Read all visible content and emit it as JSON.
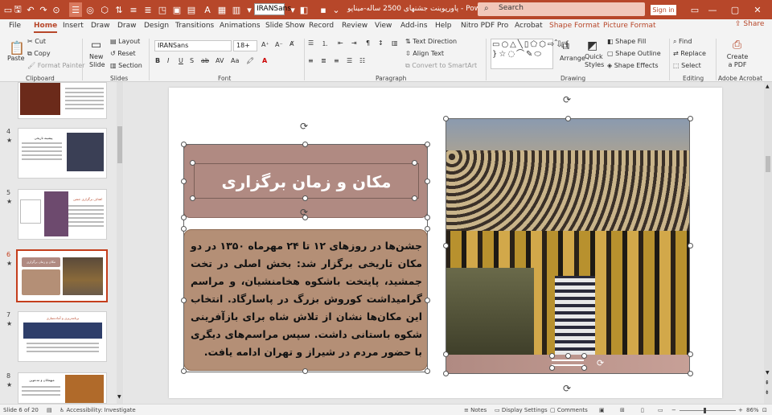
{
  "title_bar": {
    "font_name": "IRANSans",
    "document_title": "پاورپوینت جشنهای 2500 ساله-میناپو - PowerPoint",
    "search_placeholder": "Search",
    "sign_in": "Sign in"
  },
  "tabs": [
    "File",
    "Home",
    "Insert",
    "Draw",
    "Draw",
    "Design",
    "Transitions",
    "Animations",
    "Slide Show",
    "Record",
    "Review",
    "View",
    "Add-ins",
    "Help",
    "Nitro PDF Pro",
    "Acrobat",
    "Shape Format",
    "Picture Format"
  ],
  "active_tab": "Home",
  "share_label": "Share",
  "ribbon": {
    "clipboard": {
      "paste": "Paste",
      "cut": "Cut",
      "copy": "Copy",
      "format_painter": "Format Painter",
      "group": "Clipboard"
    },
    "slides": {
      "new_slide": "New Slide",
      "layout": "Layout",
      "reset": "Reset",
      "section": "Section",
      "group": "Slides"
    },
    "font": {
      "font_name": "IRANSans",
      "font_size": "18+",
      "group": "Font"
    },
    "paragraph": {
      "text_direction": "Text Direction",
      "align_text": "Align Text",
      "convert_smartart": "Convert to SmartArt",
      "group": "Paragraph"
    },
    "drawing": {
      "arrange": "Arrange",
      "quick_styles": "Quick Styles",
      "shape_fill": "Shape Fill",
      "shape_outline": "Shape Outline",
      "shape_effects": "Shape Effects",
      "group": "Drawing"
    },
    "editing": {
      "find": "Find",
      "replace": "Replace",
      "select": "Select",
      "group": "Editing"
    },
    "adobe": {
      "create_pdf": "Create a PDF",
      "group": "Adobe Acrobat"
    }
  },
  "thumbnails": [
    {
      "num": "4",
      "title": "پیشینه تاریخی"
    },
    {
      "num": "5",
      "title": "اهداف برگزاری جشن"
    },
    {
      "num": "6",
      "title": "مکان و زمان برگزاری"
    },
    {
      "num": "7",
      "title": "برنامه‌ریزی و آماده‌سازی"
    },
    {
      "num": "8",
      "title": "میهمانان و مدعوین"
    }
  ],
  "slide": {
    "heading": "مکان و زمان برگزاری",
    "body": "جشن‌ها در روزهای ۱۲ تا ۲۴ مهرماه ۱۳۵۰ در دو مکان تاریخی برگزار شد: بخش اصلی در تخت جمشید، پایتخت باشکوه هخامنشیان، و مراسم گرامیداشت کوروش بزرگ در پاسارگاد. انتخاب این مکان‌ها نشان از تلاش شاه برای بازآفرینی شکوه باستانی داشت. سپس مراسم‌های دیگری با حضور مردم در شیراز و تهران ادامه یافت."
  },
  "status_bar": {
    "slide_info": "Slide 6 of 20",
    "accessibility": "Accessibility: Investigate",
    "notes": "Notes",
    "display_settings": "Display Settings",
    "comments": "Comments",
    "zoom": "86%"
  },
  "colors": {
    "brand": "#b7472a",
    "heading_box": "#b08a82",
    "body_box": "#b48f76"
  }
}
